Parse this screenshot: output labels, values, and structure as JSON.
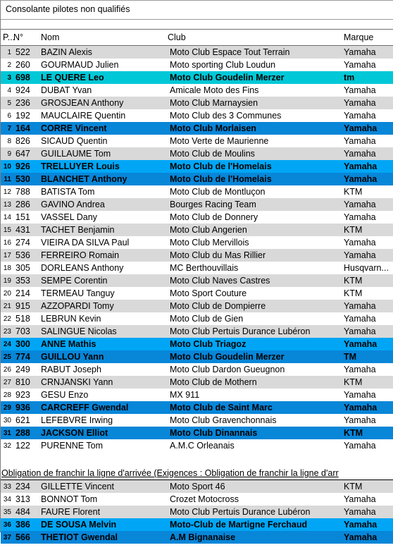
{
  "title": "Consolante pilotes non qualifiés",
  "columns": {
    "position": "P...",
    "number": "N°",
    "name": "Nom",
    "club": "Club",
    "brand": "Marque"
  },
  "colors": {
    "row_gray": "#d9d9d9",
    "row_white": "#ffffff",
    "highlight_cyan": "#00c8d7",
    "highlight_blue": "#0886d8",
    "highlight_light_blue": "#00a6f5"
  },
  "section_header": "Obligation de franchir la ligne d'arrivée (Exigences : Obligation de franchir la ligne d'arr",
  "rows": [
    {
      "pos": "1",
      "num": "522",
      "name": "BAZIN Alexis",
      "club": "Moto Club Espace Tout Terrain",
      "brand": "Yamaha",
      "style": "bg-gray"
    },
    {
      "pos": "2",
      "num": "260",
      "name": "GOURMAUD Julien",
      "club": "Moto sporting Club Loudun",
      "brand": "Yamaha",
      "style": "bg-white"
    },
    {
      "pos": "3",
      "num": "698",
      "name": "LE QUERE Leo",
      "club": "Moto Club Goudelin Merzer",
      "brand": "tm",
      "style": "bg-cyan"
    },
    {
      "pos": "4",
      "num": "924",
      "name": "DUBAT Yvan",
      "club": "Amicale Moto des Fins",
      "brand": "Yamaha",
      "style": "bg-white"
    },
    {
      "pos": "5",
      "num": "236",
      "name": "GROSJEAN Anthony",
      "club": "Moto Club Marnaysien",
      "brand": "Yamaha",
      "style": "bg-gray"
    },
    {
      "pos": "6",
      "num": "192",
      "name": "MAUCLAIRE Quentin",
      "club": "Moto Club des 3 Communes",
      "brand": "Yamaha",
      "style": "bg-white"
    },
    {
      "pos": "7",
      "num": "164",
      "name": "CORRE Vincent",
      "club": "Moto Club Morlaisen",
      "brand": "Yamaha",
      "style": "bg-blue"
    },
    {
      "pos": "8",
      "num": "826",
      "name": "SICAUD Quentin",
      "club": "Moto Verte de Maurienne",
      "brand": "Yamaha",
      "style": "bg-white"
    },
    {
      "pos": "9",
      "num": "647",
      "name": "GUILLAUME Tom",
      "club": "Moto Club de Moulins",
      "brand": "Yamaha",
      "style": "bg-gray"
    },
    {
      "pos": "10",
      "num": "926",
      "name": "TRELLUYER Louis",
      "club": "Moto Club de l'Homelais",
      "brand": "Yamaha",
      "style": "bg-lblue"
    },
    {
      "pos": "11",
      "num": "530",
      "name": "BLANCHET Anthony",
      "club": "Moto Club de l'Homelais",
      "brand": "Yamaha",
      "style": "bg-blue"
    },
    {
      "pos": "12",
      "num": "788",
      "name": "BATISTA Tom",
      "club": "Moto Club de Montluçon",
      "brand": "KTM",
      "style": "bg-white"
    },
    {
      "pos": "13",
      "num": "286",
      "name": "GAVINO Andrea",
      "club": "Bourges Racing Team",
      "brand": "Yamaha",
      "style": "bg-gray"
    },
    {
      "pos": "14",
      "num": "151",
      "name": "VASSEL Dany",
      "club": "Moto Club de Donnery",
      "brand": "Yamaha",
      "style": "bg-white"
    },
    {
      "pos": "15",
      "num": "431",
      "name": "TACHET Benjamin",
      "club": "Moto Club Angerien",
      "brand": "KTM",
      "style": "bg-gray"
    },
    {
      "pos": "16",
      "num": "274",
      "name": "VIEIRA DA SILVA Paul",
      "club": "Moto Club Mervillois",
      "brand": "Yamaha",
      "style": "bg-white"
    },
    {
      "pos": "17",
      "num": "536",
      "name": "FERREIRO Romain",
      "club": "Moto Club du Mas Rillier",
      "brand": "Yamaha",
      "style": "bg-gray"
    },
    {
      "pos": "18",
      "num": "305",
      "name": "DORLEANS Anthony",
      "club": "MC Berthouvillais",
      "brand": "Husqvarn...",
      "style": "bg-white"
    },
    {
      "pos": "19",
      "num": "353",
      "name": "SEMPE Corentin",
      "club": "Moto Club Naves Castres",
      "brand": "KTM",
      "style": "bg-gray"
    },
    {
      "pos": "20",
      "num": "214",
      "name": "TERMEAU Tanguy",
      "club": "Moto Sport Couture",
      "brand": "KTM",
      "style": "bg-white"
    },
    {
      "pos": "21",
      "num": "915",
      "name": "AZZOPARDI Tomy",
      "club": "Moto Club de Dompierre",
      "brand": "Yamaha",
      "style": "bg-gray"
    },
    {
      "pos": "22",
      "num": "518",
      "name": "LEBRUN Kevin",
      "club": "Moto Club de Gien",
      "brand": "Yamaha",
      "style": "bg-white"
    },
    {
      "pos": "23",
      "num": "703",
      "name": "SALINGUE Nicolas",
      "club": "Moto Club Pertuis Durance Lubéron",
      "brand": "Yamaha",
      "style": "bg-gray"
    },
    {
      "pos": "24",
      "num": "300",
      "name": "ANNE Mathis",
      "club": "Moto Club Triagoz",
      "brand": "Yamaha",
      "style": "bg-lblue"
    },
    {
      "pos": "25",
      "num": "774",
      "name": "GUILLOU Yann",
      "club": "Moto Club Goudelin Merzer",
      "brand": "TM",
      "style": "bg-blue"
    },
    {
      "pos": "26",
      "num": "249",
      "name": "RABUT Joseph",
      "club": "Moto Club Dardon Gueugnon",
      "brand": "Yamaha",
      "style": "bg-white"
    },
    {
      "pos": "27",
      "num": "810",
      "name": "CRNJANSKI Yann",
      "club": "Moto Club de Mothern",
      "brand": "KTM",
      "style": "bg-gray"
    },
    {
      "pos": "28",
      "num": "923",
      "name": "GESU Enzo",
      "club": "MX 911",
      "brand": "Yamaha",
      "style": "bg-white"
    },
    {
      "pos": "29",
      "num": "936",
      "name": "CARCREFF Gwendal",
      "club": "Moto Club de Saint Marc",
      "brand": "Yamaha",
      "style": "bg-blue"
    },
    {
      "pos": "30",
      "num": "621",
      "name": "LEFEBVRE Irwing",
      "club": "Moto Club Gravenchonnais",
      "brand": "Yamaha",
      "style": "bg-white"
    },
    {
      "pos": "31",
      "num": "288",
      "name": "JACKSON Elliot",
      "club": "Moto Club Dinannais",
      "brand": "KTM",
      "style": "bg-blue"
    },
    {
      "pos": "32",
      "num": "122",
      "name": "PURENNE Tom",
      "club": "A.M.C Orleanais",
      "brand": "Yamaha",
      "style": "bg-white"
    }
  ],
  "rows_section2": [
    {
      "pos": "33",
      "num": "234",
      "name": "GILLETTE Vincent",
      "club": "Moto Sport 46",
      "brand": "KTM",
      "style": "bg-gray"
    },
    {
      "pos": "34",
      "num": "313",
      "name": "BONNOT Tom",
      "club": "Crozet Motocross",
      "brand": "Yamaha",
      "style": "bg-white"
    },
    {
      "pos": "35",
      "num": "484",
      "name": "FAURE Florent",
      "club": "Moto Club Pertuis Durance Lubéron",
      "brand": "Yamaha",
      "style": "bg-gray"
    },
    {
      "pos": "36",
      "num": "386",
      "name": "DE SOUSA Melvin",
      "club": "Moto-Club de Martigne Ferchaud",
      "brand": "Yamaha",
      "style": "bg-lblue"
    },
    {
      "pos": "37",
      "num": "566",
      "name": "THETIOT Gwendal",
      "club": "A.M Bignanaise",
      "brand": "Yamaha",
      "style": "bg-blue"
    }
  ]
}
